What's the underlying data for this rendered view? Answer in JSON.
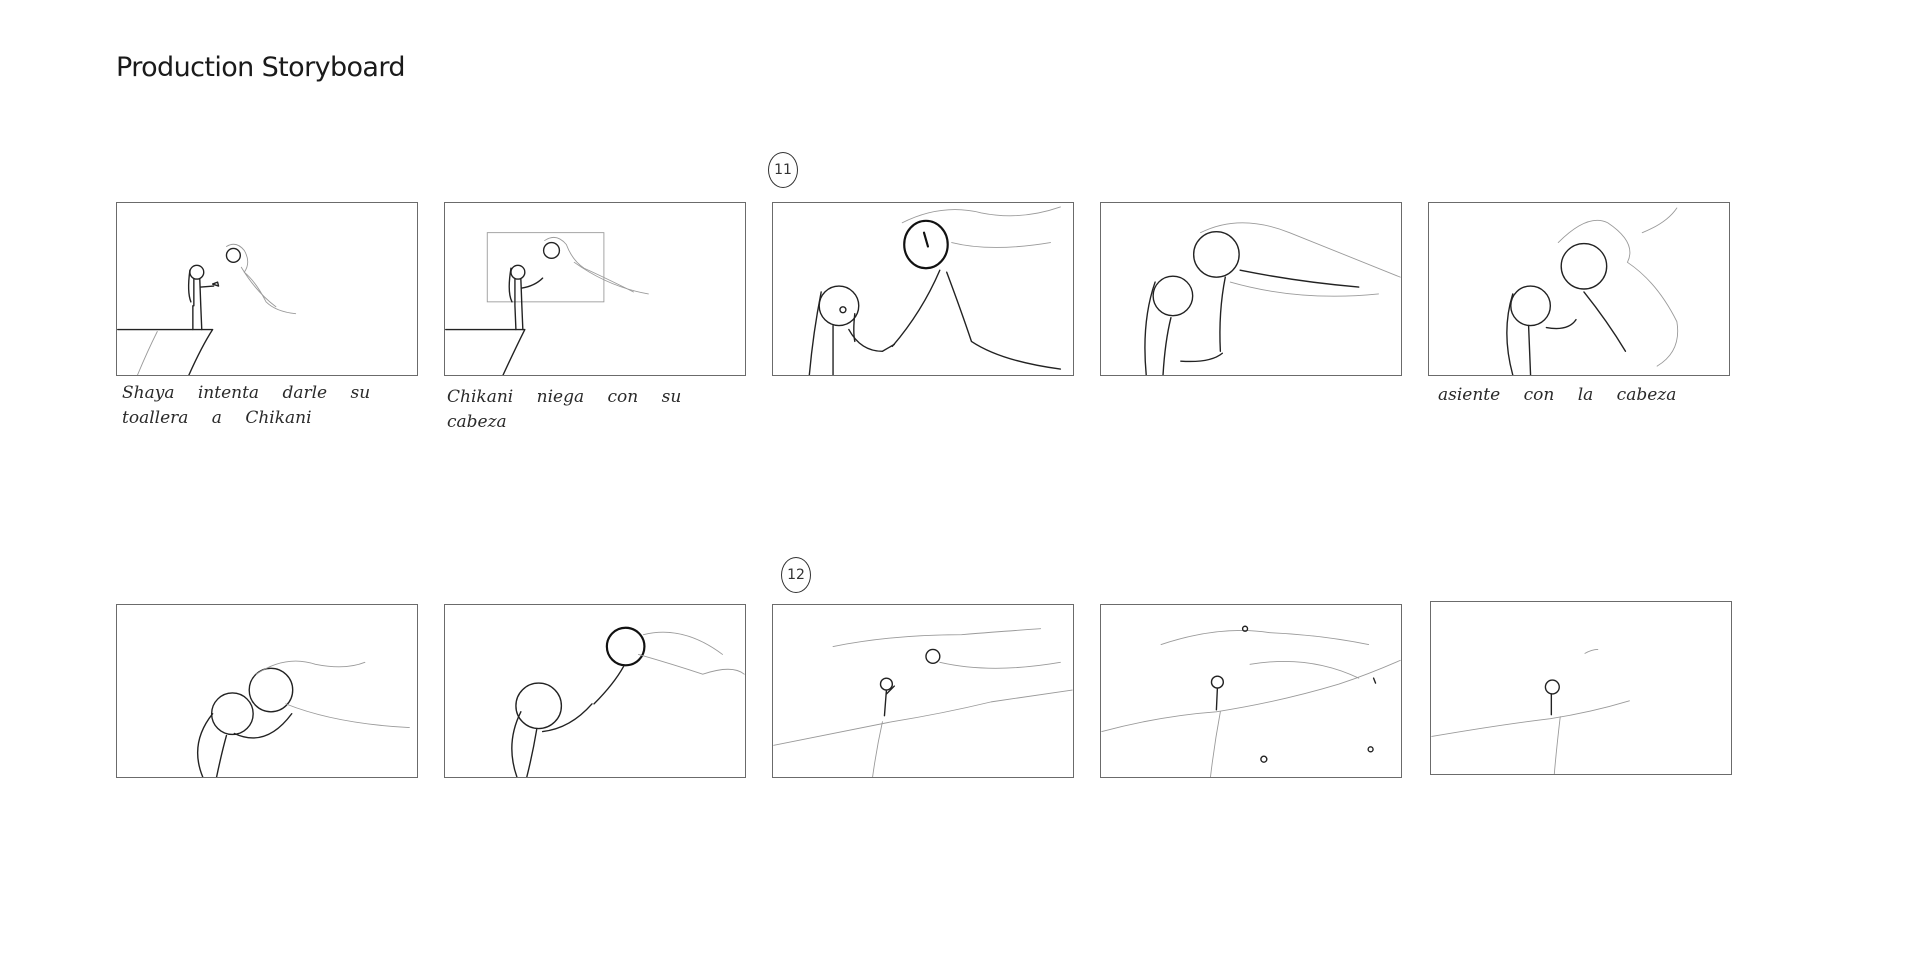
{
  "page": {
    "title": "Production Storyboard"
  },
  "shots": [
    {
      "number": "11"
    },
    {
      "number": "12"
    }
  ],
  "rows": [
    {
      "panels": [
        {
          "caption": "Shaya intenta darle su toallera a Chikani"
        },
        {
          "caption": "Chikani niega con su cabeza"
        },
        {
          "caption": ""
        },
        {
          "caption": ""
        },
        {
          "caption": "asiente con la cabeza"
        }
      ]
    },
    {
      "panels": [
        {
          "caption": ""
        },
        {
          "caption": ""
        },
        {
          "caption": ""
        },
        {
          "caption": ""
        },
        {
          "caption": ""
        }
      ]
    }
  ]
}
